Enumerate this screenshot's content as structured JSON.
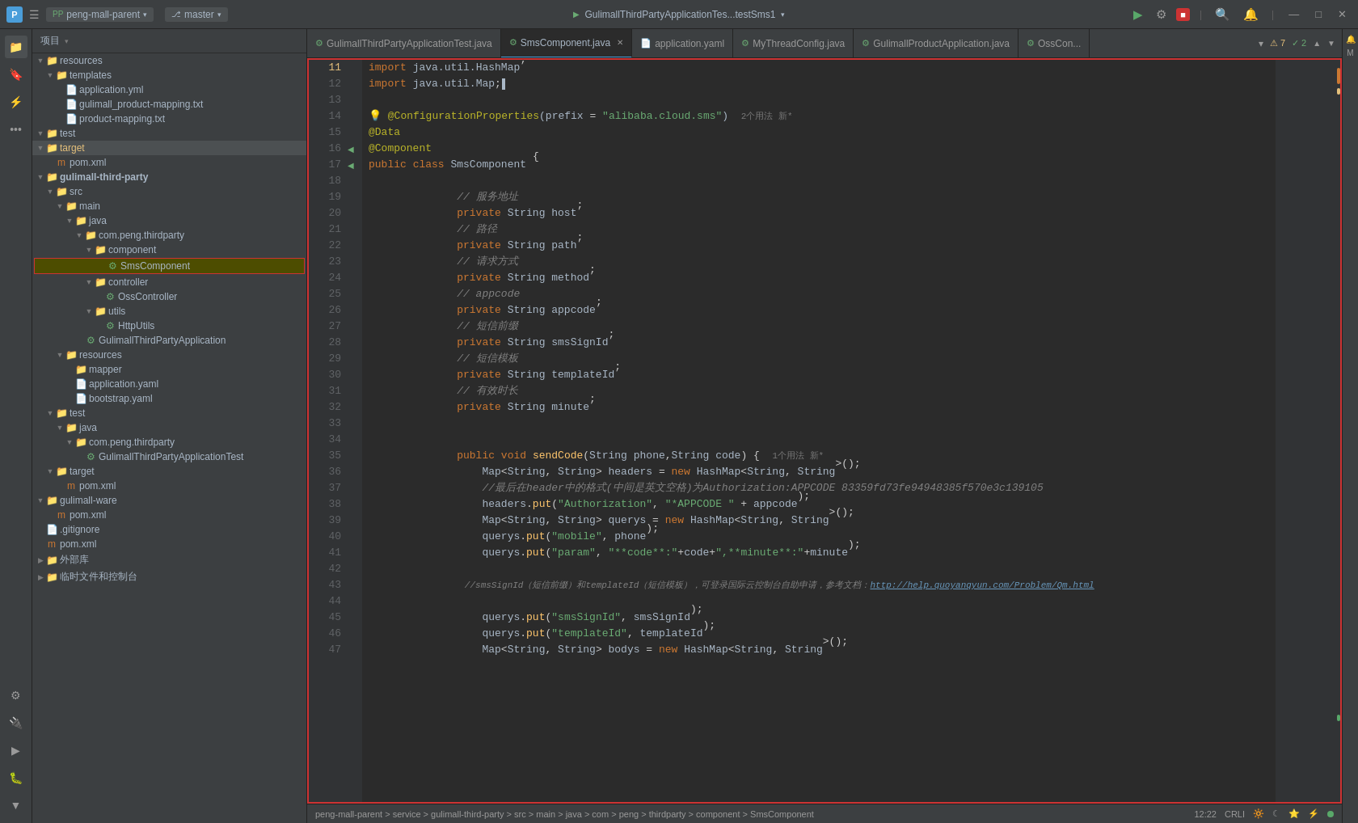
{
  "titlebar": {
    "project_label": "peng-mall-parent",
    "branch_label": "master",
    "run_name": "GulimallThirdPartyApplicationTes...testSms1",
    "run_btn": "▶",
    "stop_btn": "■",
    "minimize": "—",
    "maximize": "□",
    "close": "✕"
  },
  "sidebar": {
    "header": "项目",
    "items": [
      {
        "level": 0,
        "arrow": "▼",
        "icon": "📁",
        "label": "resources",
        "type": "folder"
      },
      {
        "level": 1,
        "arrow": "▼",
        "icon": "📁",
        "label": "templates",
        "type": "folder"
      },
      {
        "level": 2,
        "arrow": "",
        "icon": "📄",
        "label": "application.yml",
        "type": "yaml"
      },
      {
        "level": 2,
        "arrow": "",
        "icon": "📄",
        "label": "gulimall_product-mapping.txt",
        "type": "txt"
      },
      {
        "level": 2,
        "arrow": "",
        "icon": "📄",
        "label": "product-mapping.txt",
        "type": "txt"
      },
      {
        "level": 0,
        "arrow": "▼",
        "icon": "📁",
        "label": "test",
        "type": "folder"
      },
      {
        "level": 0,
        "arrow": "▼",
        "icon": "📁",
        "label": "target",
        "type": "folder",
        "selected": true
      },
      {
        "level": 1,
        "arrow": "",
        "icon": "📄",
        "label": "pom.xml",
        "type": "xml"
      },
      {
        "level": 0,
        "arrow": "▼",
        "icon": "📁",
        "label": "gulimall-third-party",
        "type": "folder"
      },
      {
        "level": 1,
        "arrow": "▼",
        "icon": "📁",
        "label": "src",
        "type": "folder"
      },
      {
        "level": 2,
        "arrow": "▼",
        "icon": "📁",
        "label": "main",
        "type": "folder"
      },
      {
        "level": 3,
        "arrow": "▼",
        "icon": "📁",
        "label": "java",
        "type": "folder"
      },
      {
        "level": 4,
        "arrow": "▼",
        "icon": "📁",
        "label": "com.peng.thirdparty",
        "type": "folder"
      },
      {
        "level": 5,
        "arrow": "▼",
        "icon": "📁",
        "label": "component",
        "type": "folder"
      },
      {
        "level": 6,
        "arrow": "",
        "icon": "⚙",
        "label": "SmsComponent",
        "type": "component",
        "highlighted": true
      },
      {
        "level": 5,
        "arrow": "▼",
        "icon": "📁",
        "label": "controller",
        "type": "folder"
      },
      {
        "level": 6,
        "arrow": "",
        "icon": "⚙",
        "label": "OssController",
        "type": "component"
      },
      {
        "level": 5,
        "arrow": "▼",
        "icon": "📁",
        "label": "utils",
        "type": "folder"
      },
      {
        "level": 6,
        "arrow": "",
        "icon": "⚙",
        "label": "HttpUtils",
        "type": "component"
      },
      {
        "level": 4,
        "arrow": "",
        "icon": "⚙",
        "label": "GulimallThirdPartyApplication",
        "type": "component"
      },
      {
        "level": 3,
        "arrow": "▼",
        "icon": "📁",
        "label": "resources",
        "type": "folder"
      },
      {
        "level": 4,
        "arrow": "",
        "icon": "📁",
        "label": "mapper",
        "type": "folder"
      },
      {
        "level": 4,
        "arrow": "",
        "icon": "📄",
        "label": "application.yaml",
        "type": "yaml"
      },
      {
        "level": 4,
        "arrow": "",
        "icon": "📄",
        "label": "bootstrap.yaml",
        "type": "yaml"
      },
      {
        "level": 2,
        "arrow": "▼",
        "icon": "📁",
        "label": "test",
        "type": "folder"
      },
      {
        "level": 3,
        "arrow": "▼",
        "icon": "📁",
        "label": "java",
        "type": "folder"
      },
      {
        "level": 4,
        "arrow": "▼",
        "icon": "📁",
        "label": "com.peng.thirdparty",
        "type": "folder"
      },
      {
        "level": 5,
        "arrow": "",
        "icon": "⚙",
        "label": "GulimallThirdPartyApplicationTest",
        "type": "component"
      },
      {
        "level": 1,
        "arrow": "▼",
        "icon": "📁",
        "label": "target",
        "type": "folder"
      },
      {
        "level": 2,
        "arrow": "",
        "icon": "📄",
        "label": "pom.xml",
        "type": "xml"
      },
      {
        "level": 0,
        "arrow": "▼",
        "icon": "📁",
        "label": "gulimall-ware",
        "type": "folder"
      },
      {
        "level": 1,
        "arrow": "",
        "icon": "📄",
        "label": "pom.xml",
        "type": "xml"
      },
      {
        "level": 0,
        "arrow": "",
        "icon": "📄",
        "label": ".gitignore",
        "type": "gitignore"
      },
      {
        "level": 0,
        "arrow": "",
        "icon": "📄",
        "label": "pom.xml",
        "type": "xml"
      },
      {
        "level": 0,
        "arrow": "▶",
        "icon": "📁",
        "label": "外部库",
        "type": "folder"
      },
      {
        "level": 0,
        "arrow": "▶",
        "icon": "📁",
        "label": "临时文件和控制台",
        "type": "folder"
      }
    ]
  },
  "tabs": [
    {
      "label": "GulimallThirdPartyApplicationTest.java",
      "active": false,
      "icon": "⚙"
    },
    {
      "label": "SmsComponent.java",
      "active": true,
      "icon": "⚙",
      "closable": true
    },
    {
      "label": "application.yaml",
      "active": false,
      "icon": "📄"
    },
    {
      "label": "MyThreadConfig.java",
      "active": false,
      "icon": "⚙"
    },
    {
      "label": "GulimallProductApplication.java",
      "active": false,
      "icon": "⚙"
    },
    {
      "label": "OssCon...",
      "active": false,
      "icon": "⚙"
    }
  ],
  "tab_badges": {
    "warnings": "7",
    "ok": "2"
  },
  "code": {
    "lines": [
      {
        "num": 11,
        "content": "import java.util.HashMap;"
      },
      {
        "num": 12,
        "content": "import java.util.Map;"
      },
      {
        "num": 13,
        "content": ""
      },
      {
        "num": 14,
        "content": "@ConfigurationProperties(prefix = \"alibaba.cloud.sms\")  2个用法  新*"
      },
      {
        "num": 15,
        "content": "@Data"
      },
      {
        "num": 16,
        "content": "@Component"
      },
      {
        "num": 17,
        "content": "public class SmsComponent {"
      },
      {
        "num": 18,
        "content": ""
      },
      {
        "num": 19,
        "content": "    // 服务地址"
      },
      {
        "num": 20,
        "content": "    private String host;"
      },
      {
        "num": 21,
        "content": "    // 路径"
      },
      {
        "num": 22,
        "content": "    private String path;"
      },
      {
        "num": 23,
        "content": "    // 请求方式"
      },
      {
        "num": 24,
        "content": "    private String method;"
      },
      {
        "num": 25,
        "content": "    // appcode"
      },
      {
        "num": 26,
        "content": "    private String appcode;"
      },
      {
        "num": 27,
        "content": "    // 短信前缀"
      },
      {
        "num": 28,
        "content": "    private String smsSignId;"
      },
      {
        "num": 29,
        "content": "    // 短信模板"
      },
      {
        "num": 30,
        "content": "    private String templateId;"
      },
      {
        "num": 31,
        "content": "    // 有效时长"
      },
      {
        "num": 32,
        "content": "    private String minute;"
      },
      {
        "num": 33,
        "content": ""
      },
      {
        "num": 34,
        "content": ""
      },
      {
        "num": 35,
        "content": "    public void sendCode(String phone,String code) {  1个用法  新*"
      },
      {
        "num": 36,
        "content": "        Map<String, String> headers = new HashMap<String, String>();"
      },
      {
        "num": 37,
        "content": "        //最后在header中的格式(中间是英文空格)为Authorization:APPCODE 83359fd73fe94948385f570e3c139105"
      },
      {
        "num": 38,
        "content": "        headers.put(\"Authorization\", \"*APPCODE \" + appcode);"
      },
      {
        "num": 39,
        "content": "        Map<String, String> querys = new HashMap<String, String>();"
      },
      {
        "num": 40,
        "content": "        querys.put(\"mobile\", phone);"
      },
      {
        "num": 41,
        "content": "        querys.put(\"param\", \"**code**:\"+code+\",**minute**:\"+minute);"
      },
      {
        "num": 42,
        "content": ""
      },
      {
        "num": 43,
        "content": "        //smsSignId（短信前缀）和templateId（短信模板），可登录国际云控制台自助申请，参考文档：http://help.quoyanqyun.com/Problem/Qm.html"
      },
      {
        "num": 44,
        "content": ""
      },
      {
        "num": 45,
        "content": "        querys.put(\"smsSignId\", smsSignId);"
      },
      {
        "num": 46,
        "content": "        querys.put(\"templateId\", templateId);"
      },
      {
        "num": 47,
        "content": "        Map<String, String> bodys = new HashMap<String, String>();"
      }
    ]
  },
  "bottom_bar": {
    "breadcrumb": "peng-mall-parent > service > gulimall-third-party > src > main > java > com > peng > thirdparty > component > SmsComponent",
    "line_col": "12:22",
    "encoding": "CRLI",
    "icons": [
      "🔆",
      "☾",
      "⭐",
      "⚡"
    ]
  }
}
